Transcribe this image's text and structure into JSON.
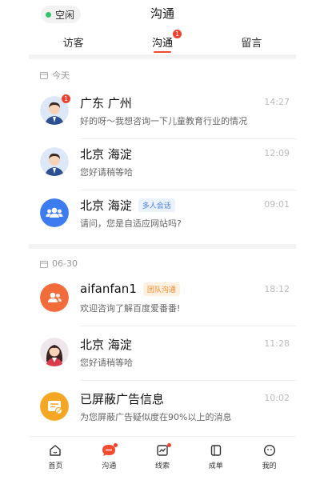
{
  "header": {
    "status_label": "空闲",
    "title": "沟通"
  },
  "tabs": [
    {
      "label": "访客",
      "active": false
    },
    {
      "label": "沟通",
      "active": true,
      "badge": "1"
    },
    {
      "label": "留言",
      "active": false
    }
  ],
  "sections": [
    {
      "date_label": "今天",
      "conversations": [
        {
          "name": "广东 广州",
          "preview": "好的呀～我想咨询一下儿童教育行业的情况",
          "time": "14:27",
          "unread": "1",
          "avatar": "male-agent-avatar"
        },
        {
          "name": "北京 海淀",
          "preview": "您好请稍等哈",
          "time": "12:09",
          "avatar": "male-agent-avatar"
        },
        {
          "name": "北京 海淀",
          "tag": "多人会话",
          "preview": "请问，您是自适应网站吗?",
          "time": "09:01",
          "avatar": "group-icon",
          "avatar_color": "#3d7bf0"
        }
      ]
    },
    {
      "date_label": "06-30",
      "conversations": [
        {
          "name": "aifanfan1",
          "tag": "团队沟通",
          "preview": "欢迎咨询了解百度爱番番!",
          "time": "18:12",
          "avatar": "team-icon",
          "avatar_color": "#f26b3a"
        },
        {
          "name": "北京 海淀",
          "preview": "您好请稍等哈",
          "time": "11:28",
          "avatar": "female-agent-avatar"
        },
        {
          "name": "已屏蔽广告信息",
          "preview": "为您屏蔽广告疑似度在90%以上的消息",
          "time": "10:02",
          "avatar": "blocked-ad-icon",
          "avatar_color": "#f5a623"
        }
      ]
    }
  ],
  "bottom_nav": [
    {
      "label": "首页",
      "icon": "home-icon"
    },
    {
      "label": "沟通",
      "icon": "chat-icon",
      "dot": true
    },
    {
      "label": "线索",
      "icon": "leads-icon",
      "dot": true
    },
    {
      "label": "成单",
      "icon": "order-icon"
    },
    {
      "label": "我的",
      "icon": "profile-icon"
    }
  ],
  "colors": {
    "accent": "#f04a2f",
    "online": "#2fc46a",
    "group_blue": "#3d7bf0",
    "team_orange": "#f26b3a",
    "blocked_yellow": "#f5a623"
  }
}
